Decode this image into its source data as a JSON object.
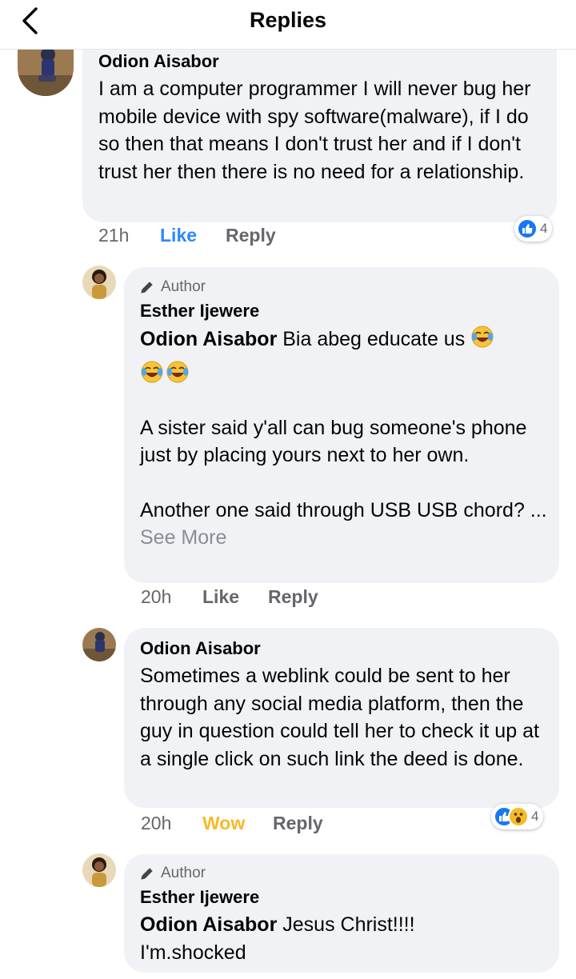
{
  "header": {
    "title": "Replies"
  },
  "comments": [
    {
      "name": "Odion Aisabor",
      "text": "I am a computer programmer I will never bug her mobile device with spy software(malware), if I do so then that means I don't trust her and if I don't trust her then there is no need for a relationship.",
      "time": "21h",
      "like_label": "Like",
      "reply_label": "Reply",
      "reaction_count": "4",
      "reactions": [
        "like-icon"
      ]
    },
    {
      "author_badge": "Author",
      "name": "Esther Ijewere",
      "mention": "Odion Aisabor",
      "text_line1": " Bia abeg educate us",
      "emojis": [
        "laughing-tears-icon",
        "laughing-tears-icon",
        "laughing-tears-icon"
      ],
      "text_para2": "A sister said y'all can bug someone's phone just by placing yours next to her own.",
      "text_para3": "Another one said through USB USB chord? ...",
      "see_more": "See More",
      "time": "20h",
      "like_label": "Like",
      "reply_label": "Reply"
    },
    {
      "name": "Odion Aisabor",
      "text": "Sometimes a weblink could be sent to her through any social media platform, then the guy in question could tell her to check it up at a single click on such link the deed is done.",
      "time": "20h",
      "reaction_label": "Wow",
      "reply_label": "Reply",
      "reaction_count": "4",
      "reactions": [
        "like-icon",
        "wow-icon"
      ]
    },
    {
      "author_badge": "Author",
      "name": "Esther Ijewere",
      "mention": "Odion Aisabor",
      "text_line1": " Jesus Christ!!!!",
      "text_line2": "I'm.shocked"
    }
  ],
  "colors": {
    "bubble": "#f0f2f5",
    "like_blue": "#2d88ff",
    "wow_yellow": "#f7b928",
    "meta_grey": "#65676b"
  }
}
